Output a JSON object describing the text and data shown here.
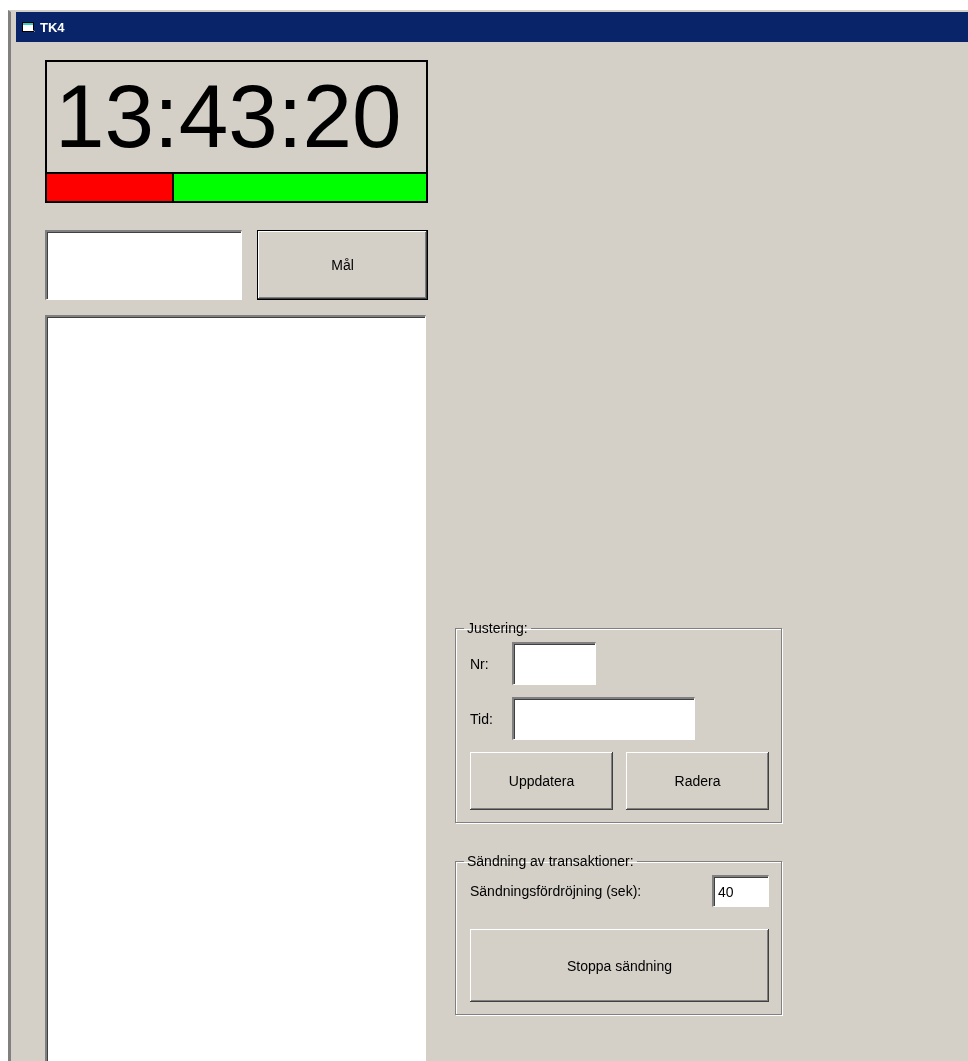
{
  "window": {
    "title": "TK4"
  },
  "clock": {
    "time": "13:43:20",
    "level": 0.33
  },
  "target": {
    "button": "Mål"
  },
  "adjustment": {
    "title": "Justering:",
    "fields": [
      {
        "label": "Nr:"
      },
      {
        "label": "Tid:"
      }
    ],
    "buttons": [
      "Uppdatera",
      "Radera"
    ]
  },
  "transmission": {
    "title": "Sändning av transaktioner:",
    "delay": {
      "label": "Sändningsfördröjning (sek):",
      "value": "40"
    },
    "button": "Stoppa sändning"
  }
}
